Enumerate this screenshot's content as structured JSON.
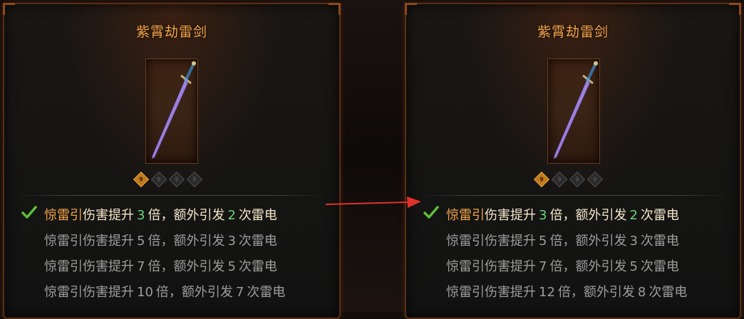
{
  "panels": [
    {
      "title": "紫霄劫雷剑",
      "gems": [
        "9",
        "9",
        "9",
        "9"
      ],
      "active_gem_index": 0,
      "tiers": [
        {
          "lead": "惊雷引",
          "pre": "伤害提升",
          "mult": "3",
          "mid": "倍，额外引发",
          "count": "2",
          "post": "次雷电",
          "active": true
        },
        {
          "lead": "惊雷引",
          "pre": "伤害提升",
          "mult": "5",
          "mid": "倍，额外引发",
          "count": "3",
          "post": "次雷电",
          "active": false
        },
        {
          "lead": "惊雷引",
          "pre": "伤害提升",
          "mult": "7",
          "mid": "倍，额外引发",
          "count": "5",
          "post": "次雷电",
          "active": false
        },
        {
          "lead": "惊雷引",
          "pre": "伤害提升",
          "mult": "10",
          "mid": "倍，额外引发",
          "count": "7",
          "post": "次雷电",
          "active": false
        }
      ]
    },
    {
      "title": "紫霄劫雷剑",
      "gems": [
        "9",
        "9",
        "9",
        "9"
      ],
      "active_gem_index": 0,
      "tiers": [
        {
          "lead": "惊雷引",
          "pre": "伤害提升",
          "mult": "3",
          "mid": "倍，额外引发",
          "count": "2",
          "post": "次雷电",
          "active": true
        },
        {
          "lead": "惊雷引",
          "pre": "伤害提升",
          "mult": "5",
          "mid": "倍，额外引发",
          "count": "3",
          "post": "次雷电",
          "active": false
        },
        {
          "lead": "惊雷引",
          "pre": "伤害提升",
          "mult": "7",
          "mid": "倍，额外引发",
          "count": "5",
          "post": "次雷电",
          "active": false
        },
        {
          "lead": "惊雷引",
          "pre": "伤害提升",
          "mult": "12",
          "mid": "倍，额外引发",
          "count": "8",
          "post": "次雷电",
          "active": false
        }
      ]
    }
  ],
  "colors": {
    "title": "#f2a34a",
    "active_lead": "#f0a24a",
    "active_number": "#6fd27a",
    "inactive_text": "#9c9c9c",
    "arrow": "#e0322a",
    "check": "#5fbf3a"
  },
  "icons": {
    "weapon": "sword-icon",
    "check": "checkmark-icon",
    "arrow": "arrow-right-icon",
    "gem": "gem-socket-icon"
  }
}
